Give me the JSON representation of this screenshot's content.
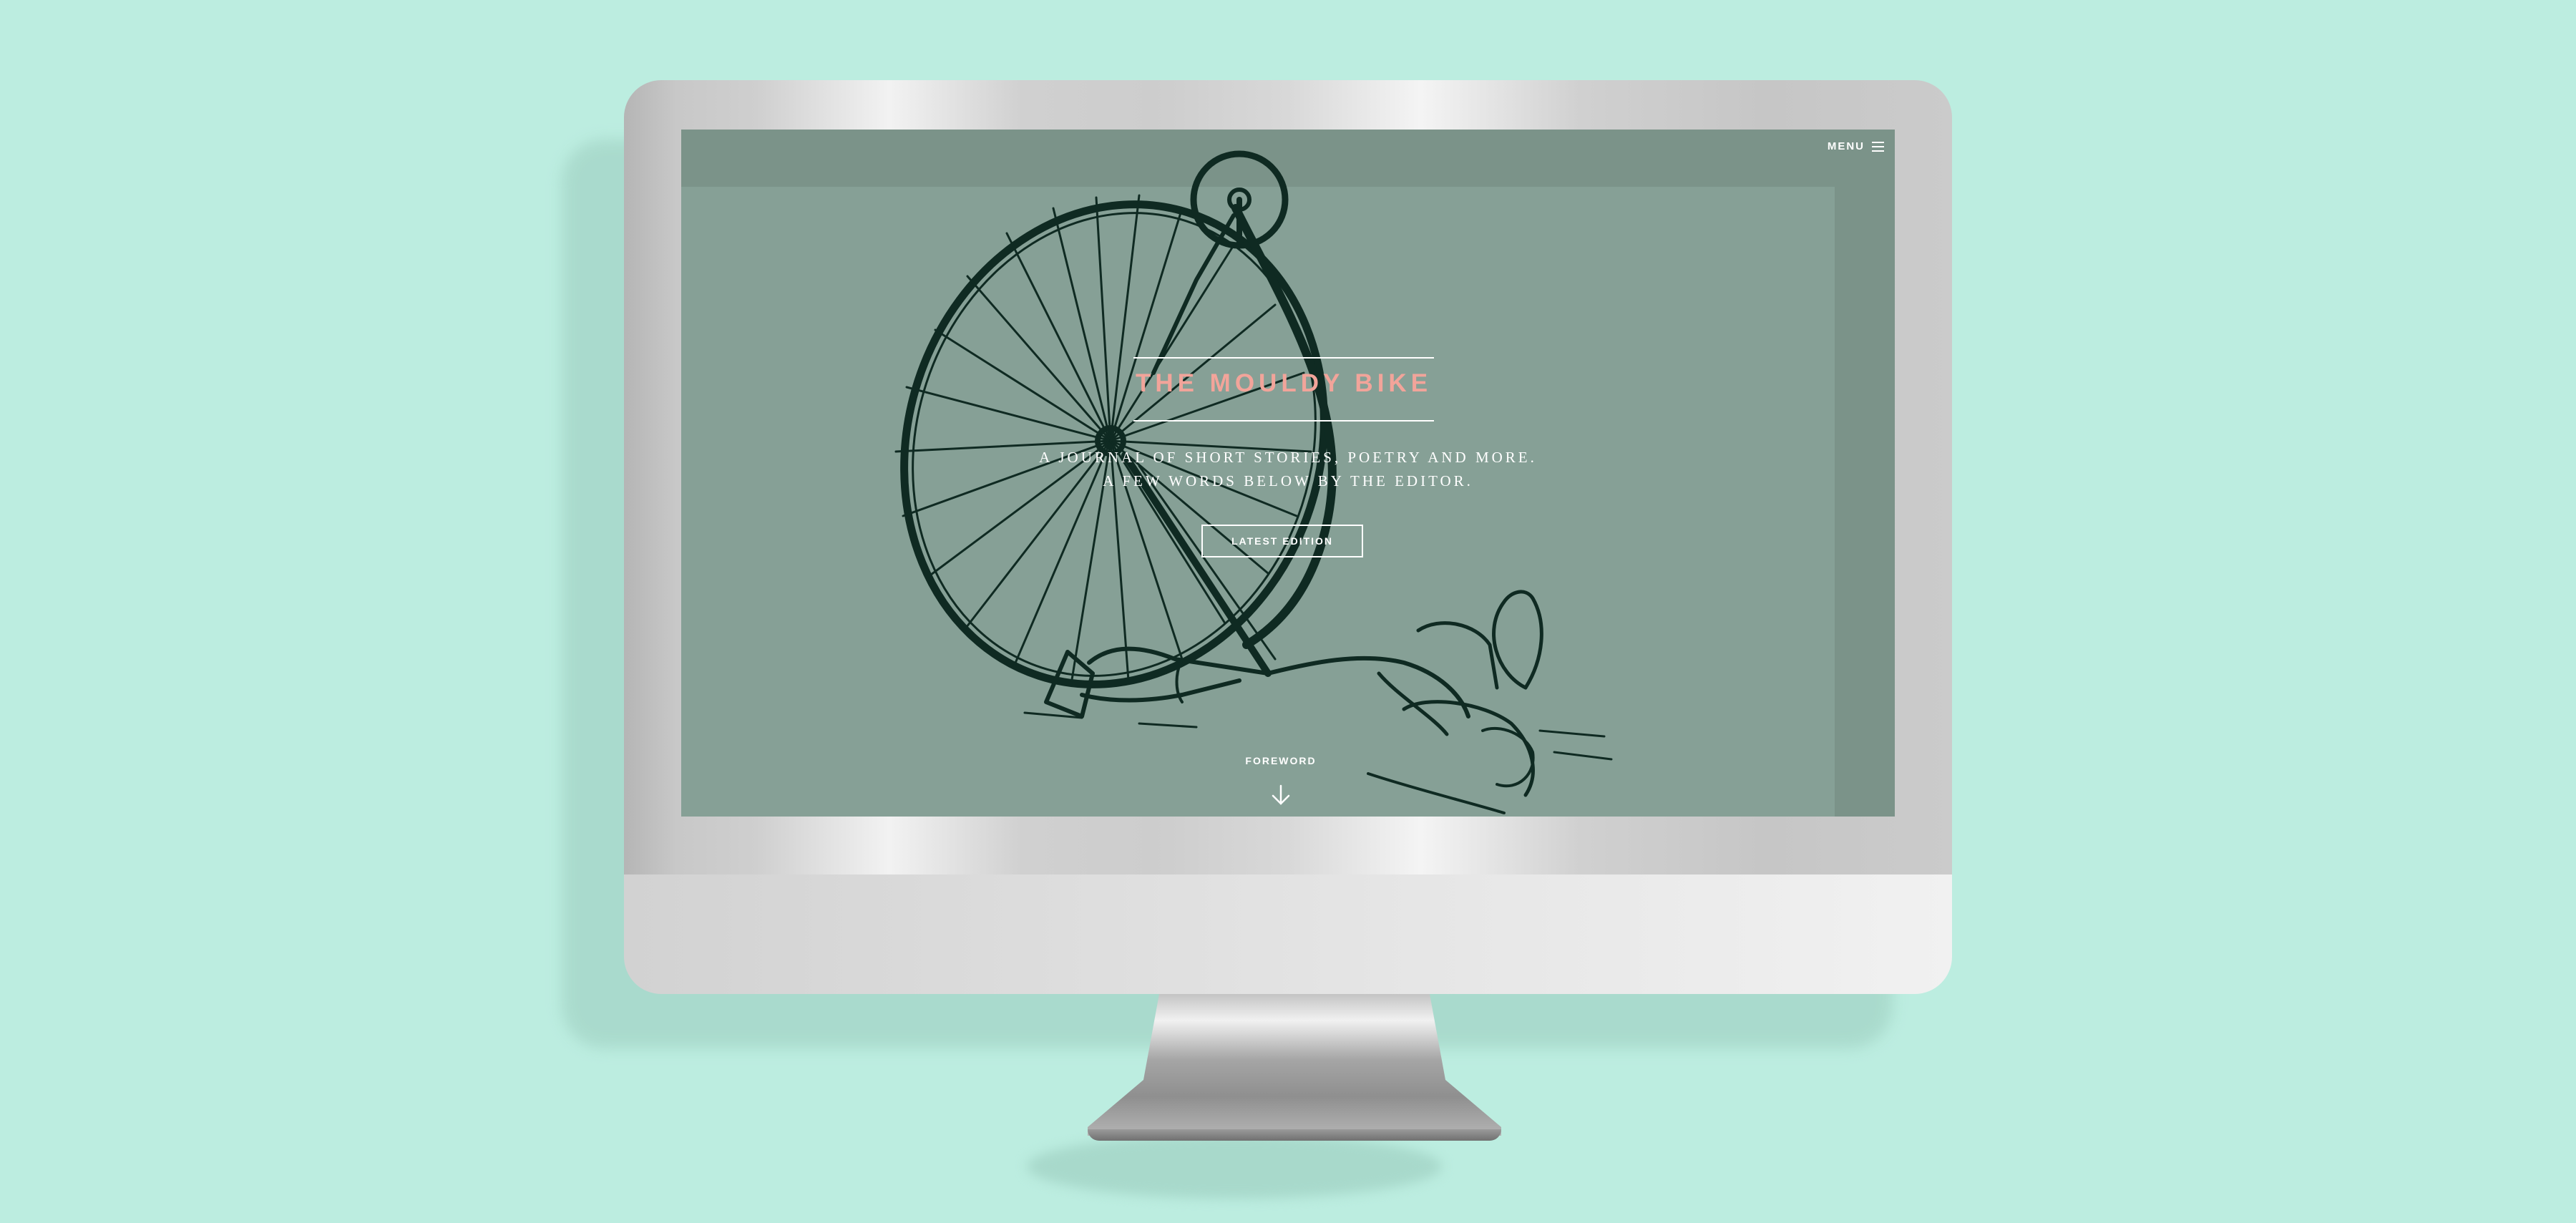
{
  "colors": {
    "background": "#bcede0",
    "screen": "#86a096",
    "title_accent": "#f2a49a",
    "ink": "#0f2a22"
  },
  "header": {
    "menu_label": "MENU",
    "menu_icon": "hamburger-icon"
  },
  "hero": {
    "title": "THE MOULDY BIKE",
    "tagline_line1": "A JOURNAL OF SHORT STORIES, POETRY AND MORE.",
    "tagline_line2": "A FEW WORDS BELOW BY THE EDITOR.",
    "cta_label": "LATEST EDITION"
  },
  "scroll": {
    "label": "FOREWORD",
    "icon": "arrow-down-icon"
  }
}
